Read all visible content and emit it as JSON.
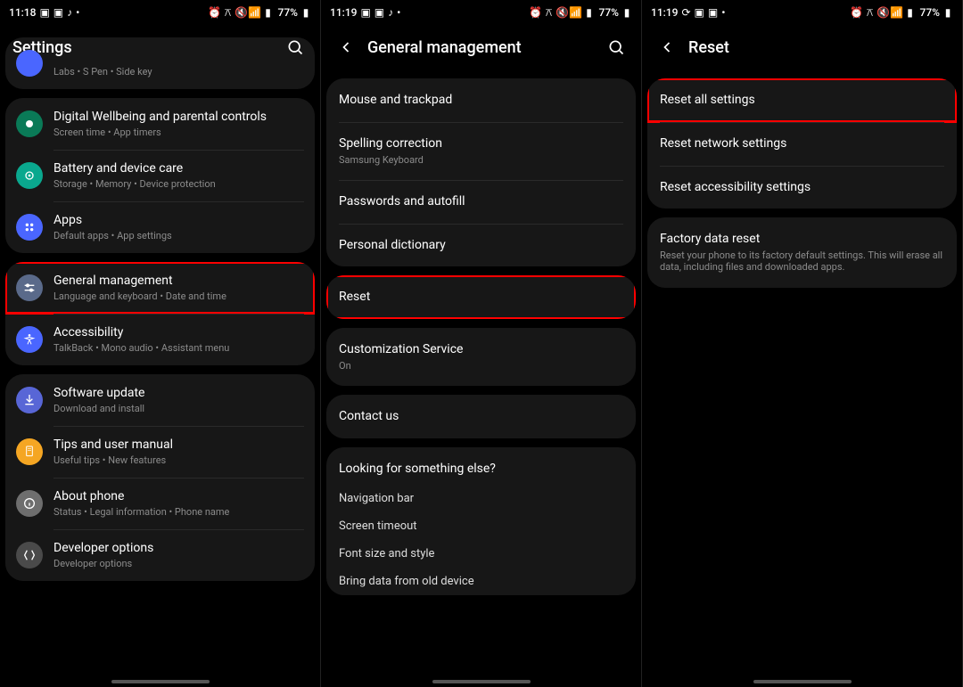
{
  "panel1": {
    "status": {
      "time": "11:18",
      "battery": "77%"
    },
    "header": {
      "title": "Settings"
    },
    "group_top": {
      "partial": {
        "sub": "Labs  •  S Pen  •  Side key"
      }
    },
    "group1": {
      "wellbeing": {
        "title": "Digital Wellbeing and parental controls",
        "sub": "Screen time  •  App timers",
        "color": "#0a7a57"
      },
      "battery": {
        "title": "Battery and device care",
        "sub": "Storage  •  Memory  •  Device protection",
        "color": "#0aa88e"
      },
      "apps": {
        "title": "Apps",
        "sub": "Default apps  •  App settings",
        "color": "#4a66ff"
      }
    },
    "group2": {
      "general": {
        "title": "General management",
        "sub": "Language and keyboard  •  Date and time",
        "color": "#4a66ff"
      },
      "access": {
        "title": "Accessibility",
        "sub": "TalkBack  •  Mono audio  •  Assistant menu",
        "color": "#4a66ff"
      }
    },
    "group3": {
      "swupdate": {
        "title": "Software update",
        "sub": "Download and install",
        "color": "#5866d6"
      },
      "tips": {
        "title": "Tips and user manual",
        "sub": "Useful tips  •  New features",
        "color": "#f5a623"
      },
      "about": {
        "title": "About phone",
        "sub": "Status  •  Legal information  •  Phone name",
        "color": "#6e6e6e"
      },
      "dev": {
        "title": "Developer options",
        "sub": "Developer options",
        "color": "#4a4a4a"
      }
    }
  },
  "panel2": {
    "status": {
      "time": "11:19",
      "battery": "77%"
    },
    "header": {
      "title": "General management"
    },
    "g1": {
      "mouse": {
        "title": "Mouse and trackpad"
      },
      "spelling": {
        "title": "Spelling correction",
        "sub": "Samsung Keyboard"
      },
      "passwords": {
        "title": "Passwords and autofill"
      },
      "dict": {
        "title": "Personal dictionary"
      }
    },
    "g2": {
      "reset": {
        "title": "Reset"
      }
    },
    "g3": {
      "custom": {
        "title": "Customization Service",
        "sub": "On"
      }
    },
    "g4": {
      "contact": {
        "title": "Contact us"
      }
    },
    "g5": {
      "label": "Looking for something else?",
      "nav": "Navigation bar",
      "timeout": "Screen timeout",
      "font": "Font size and style",
      "bring": "Bring data from old device"
    }
  },
  "panel3": {
    "status": {
      "time": "11:19",
      "battery": "77%"
    },
    "header": {
      "title": "Reset"
    },
    "g1": {
      "all": {
        "title": "Reset all settings"
      },
      "net": {
        "title": "Reset network settings"
      },
      "acc": {
        "title": "Reset accessibility settings"
      }
    },
    "g2": {
      "factory": {
        "title": "Factory data reset",
        "sub": "Reset your phone to its factory default settings. This will erase all data, including files and downloaded apps."
      }
    }
  }
}
